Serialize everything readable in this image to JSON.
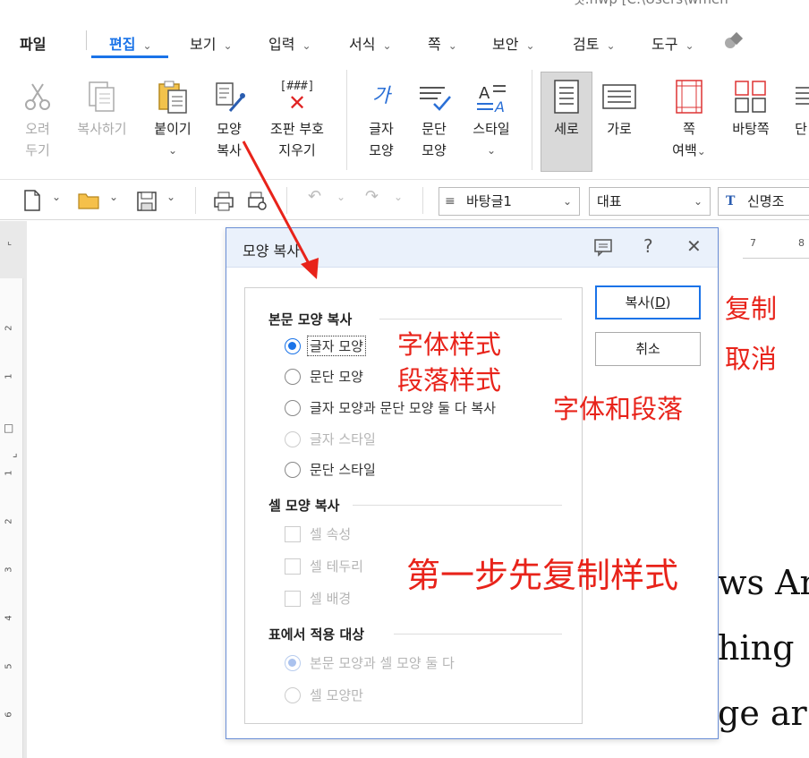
{
  "window": {
    "title_fragment": "첫.hwp [C:\\Users\\wmen"
  },
  "menubar": {
    "items": [
      {
        "label": "파일"
      },
      {
        "label": "편집"
      },
      {
        "label": "보기"
      },
      {
        "label": "입력"
      },
      {
        "label": "서식"
      },
      {
        "label": "쪽"
      },
      {
        "label": "보안"
      },
      {
        "label": "검토"
      },
      {
        "label": "도구"
      }
    ]
  },
  "ribbon": {
    "cut": {
      "l1": "오려",
      "l2": "두기"
    },
    "copy": {
      "l1": "복사하기"
    },
    "paste": {
      "l1": "붙이기"
    },
    "format_copy": {
      "l1": "모양",
      "l2": "복사"
    },
    "remove_codes": {
      "l1": "조판 부호",
      "l2": "지우기",
      "icon_text": "[###]"
    },
    "char_shape": {
      "l1": "글자",
      "l2": "모양",
      "icon_text": "가"
    },
    "para_shape": {
      "l1": "문단",
      "l2": "모양"
    },
    "style": {
      "l1": "스타일"
    },
    "portrait": {
      "l1": "세로"
    },
    "landscape": {
      "l1": "가로"
    },
    "margins": {
      "l1": "쪽",
      "l2": "여백"
    },
    "facing": {
      "l1": "바탕쪽"
    },
    "cut_off": {
      "l1": "단"
    }
  },
  "toolbar": {
    "style_combo": "바탕글1",
    "lang_combo": "대표",
    "font_combo": "신명조"
  },
  "ruler": {
    "top_numbers": [
      "7",
      "8"
    ],
    "left_numbers": [
      "2",
      "1",
      "1",
      "2",
      "3",
      "4",
      "5",
      "6"
    ]
  },
  "document": {
    "line1": "ws Ar",
    "line2": "hing",
    "line3": "ge ar",
    "fragment": "t"
  },
  "dialog": {
    "title": "모양 복사",
    "section_body": "본문 모양 복사",
    "options_body": [
      {
        "label": "글자 모양",
        "state": "selected"
      },
      {
        "label": "문단 모양",
        "state": "normal"
      },
      {
        "label": "글자 모양과 문단 모양 둘 다 복사",
        "state": "normal"
      },
      {
        "label": "글자 스타일",
        "state": "disabled"
      },
      {
        "label": "문단 스타일",
        "state": "normal"
      }
    ],
    "section_cell": "셀 모양 복사",
    "options_cell": [
      {
        "label": "셀 속성"
      },
      {
        "label": "셀 테두리"
      },
      {
        "label": "셀 배경"
      }
    ],
    "section_table": "표에서 적용 대상",
    "options_table": [
      {
        "label": "본문 모양과 셀 모양 둘 다",
        "state": "disabled-selected"
      },
      {
        "label": "셀 모양만",
        "state": "disabled"
      }
    ],
    "copy_button": {
      "text": "복사(",
      "mnemonic": "D",
      "close": ")"
    },
    "cancel_button": "취소"
  },
  "annotations": {
    "copy": "复制",
    "cancel": "取消",
    "char_style": "字体样式",
    "para_style": "段落样式",
    "both": "字体和段落",
    "step1": "第一步先复制样式",
    "color": "#e8231a"
  }
}
